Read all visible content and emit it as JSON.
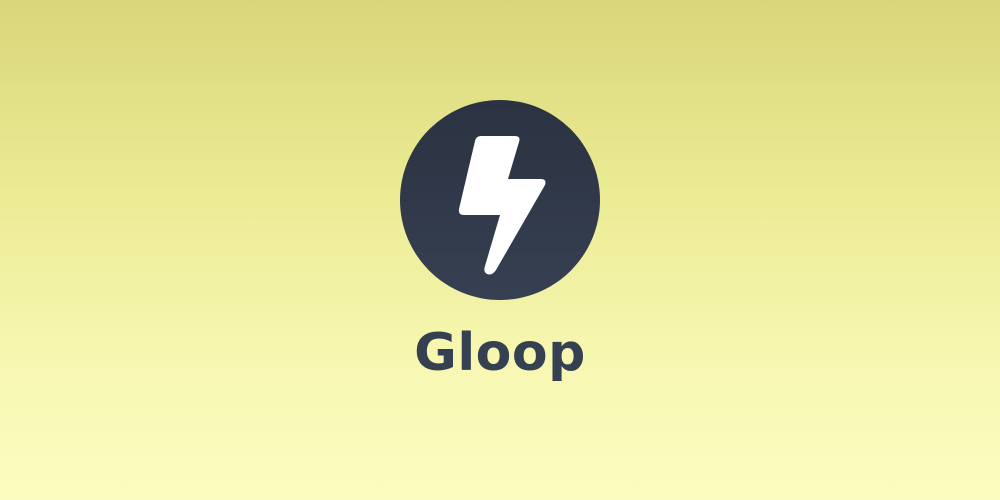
{
  "app": {
    "name": "Gloop",
    "logo_icon": "lightning-bolt-icon"
  },
  "colors": {
    "background_top": "#d9d67a",
    "background_bottom": "#fbfcbf",
    "logo_circle": "#2f3747",
    "logo_bolt": "#ffffff",
    "name_text": "#354051"
  }
}
